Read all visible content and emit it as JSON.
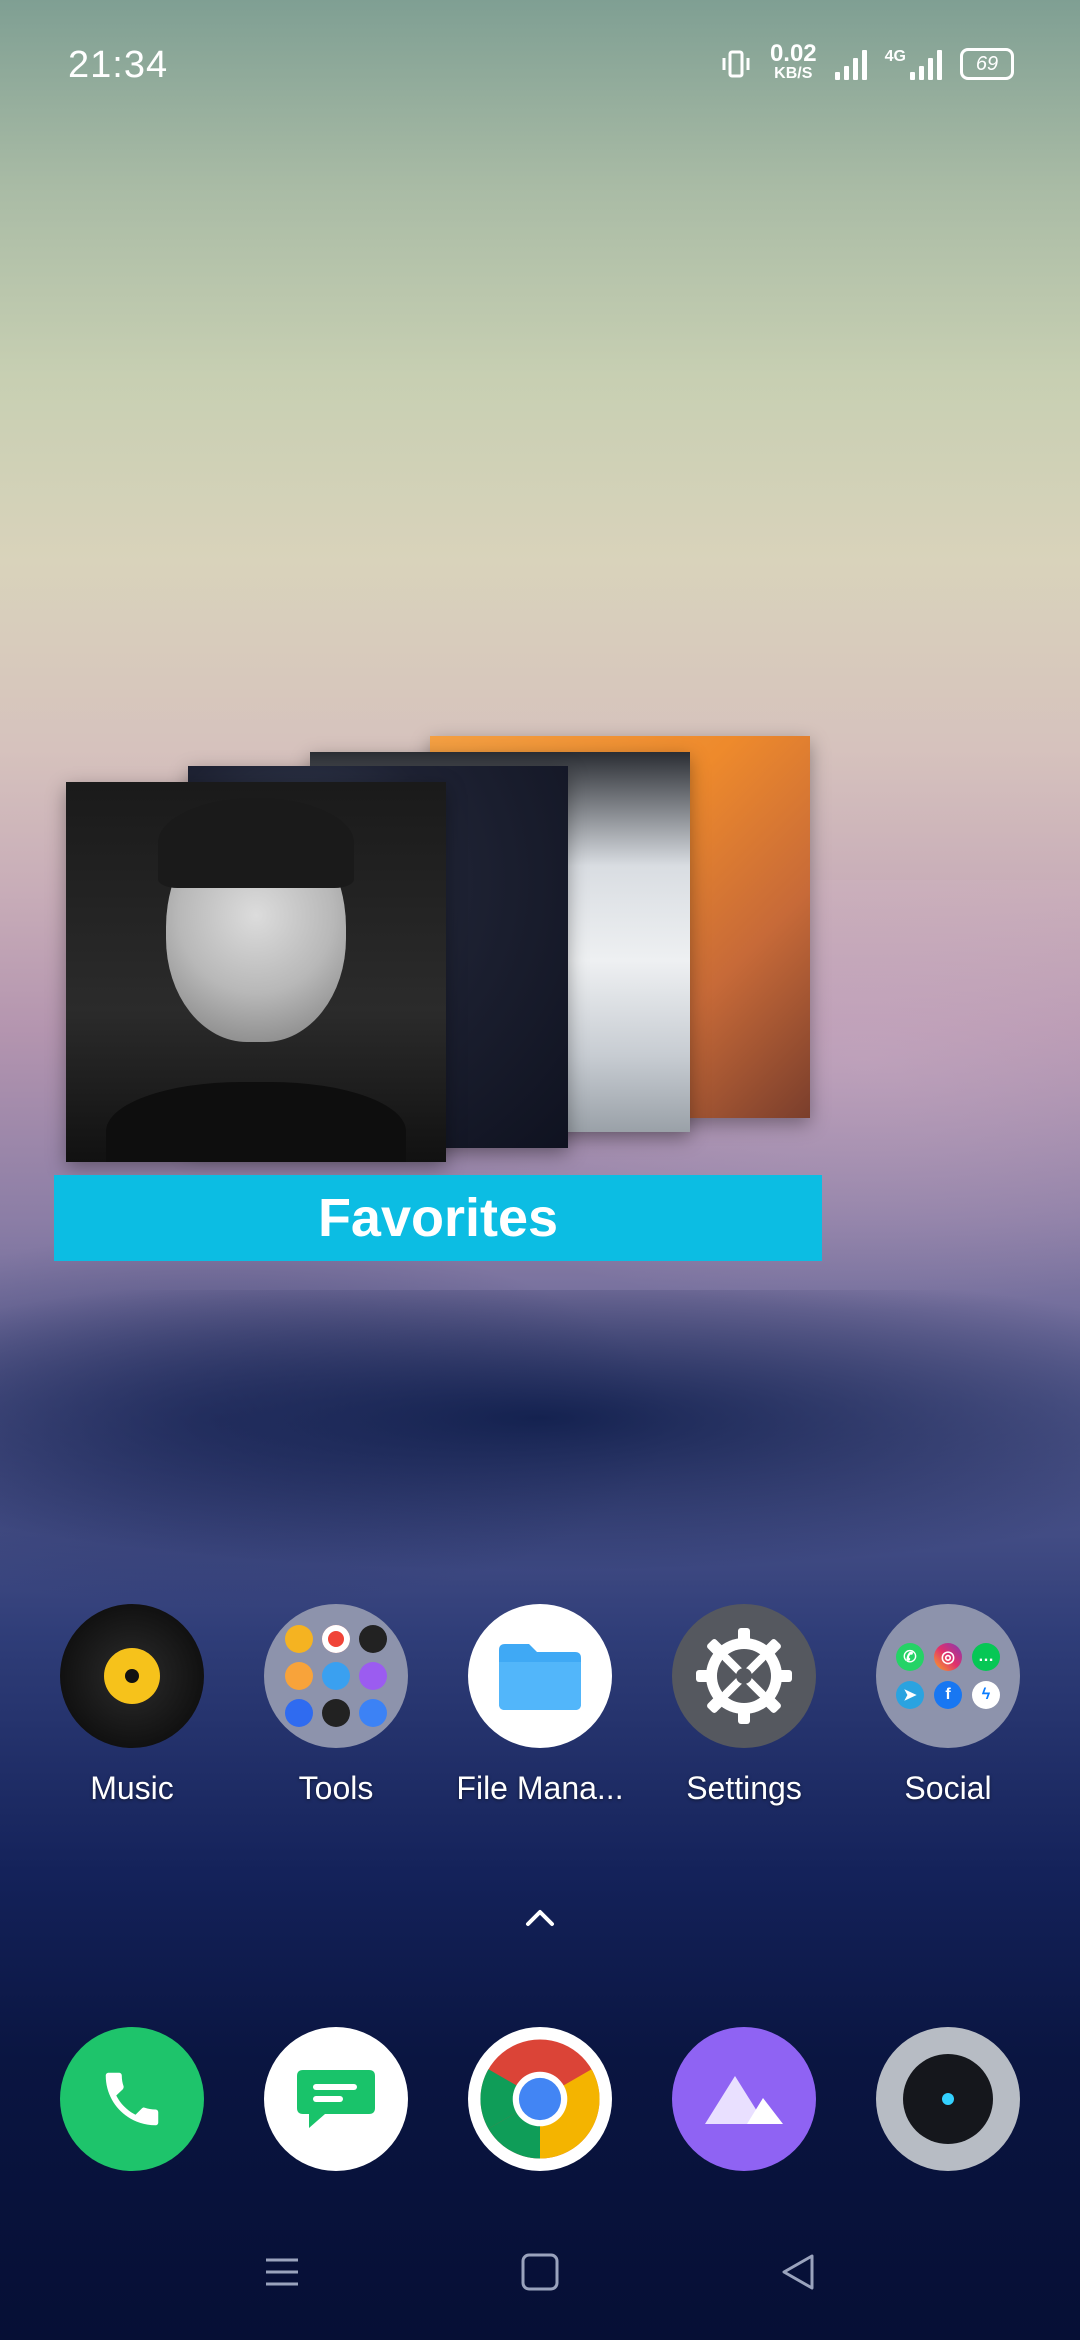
{
  "status_bar": {
    "time": "21:34",
    "speed_value": "0.02",
    "speed_unit": "KB/S",
    "network_type": "4G",
    "battery": "69"
  },
  "widget": {
    "title": "Favorites",
    "accent_color": "#0cbde3"
  },
  "home_apps": [
    {
      "label": "Music",
      "icon": "music-disc-icon"
    },
    {
      "label": "Tools",
      "icon": "tools-folder-icon"
    },
    {
      "label": "File Mana...",
      "icon": "folder-icon"
    },
    {
      "label": "Settings",
      "icon": "gear-icon"
    },
    {
      "label": "Social",
      "icon": "social-folder-icon"
    }
  ],
  "dock": [
    {
      "name": "Phone",
      "icon": "phone-icon"
    },
    {
      "name": "Messages",
      "icon": "message-icon"
    },
    {
      "name": "Chrome",
      "icon": "chrome-icon"
    },
    {
      "name": "Photos",
      "icon": "gallery-icon"
    },
    {
      "name": "Camera",
      "icon": "camera-icon"
    }
  ],
  "nav": [
    "menu-icon",
    "home-icon",
    "back-icon"
  ]
}
